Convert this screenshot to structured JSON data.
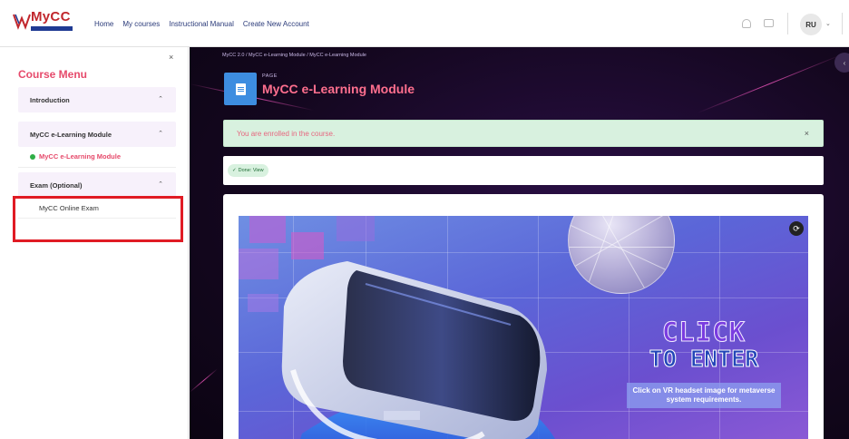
{
  "header": {
    "logo_text": "MyCC",
    "nav": [
      "Home",
      "My courses",
      "Instructional Manual",
      "Create New Account"
    ],
    "user_initials": "RU"
  },
  "sidebar": {
    "close": "×",
    "title": "Course Menu",
    "sections": [
      {
        "label": "Introduction",
        "chevron": "⌃"
      },
      {
        "label": "MyCC e-Learning Module",
        "chevron": "⌃"
      },
      {
        "label": "Exam (Optional)",
        "chevron": "⌃"
      }
    ],
    "module_item": "MyCC e-Learning Module",
    "exam_item": "MyCC Online Exam"
  },
  "main": {
    "breadcrumb": "MyCC 2.0 / MyCC e-Learning Module / MyCC e-Learning Module",
    "kicker": "PAGE",
    "title": "MyCC e-Learning Module",
    "alert": "You are enrolled in the course.",
    "alert_close": "×",
    "done_badge": "Done: View",
    "banner": {
      "line1": "CLICK",
      "line2": "TO ENTER",
      "note": "Click on VR headset image for metaverse system requirements."
    }
  }
}
